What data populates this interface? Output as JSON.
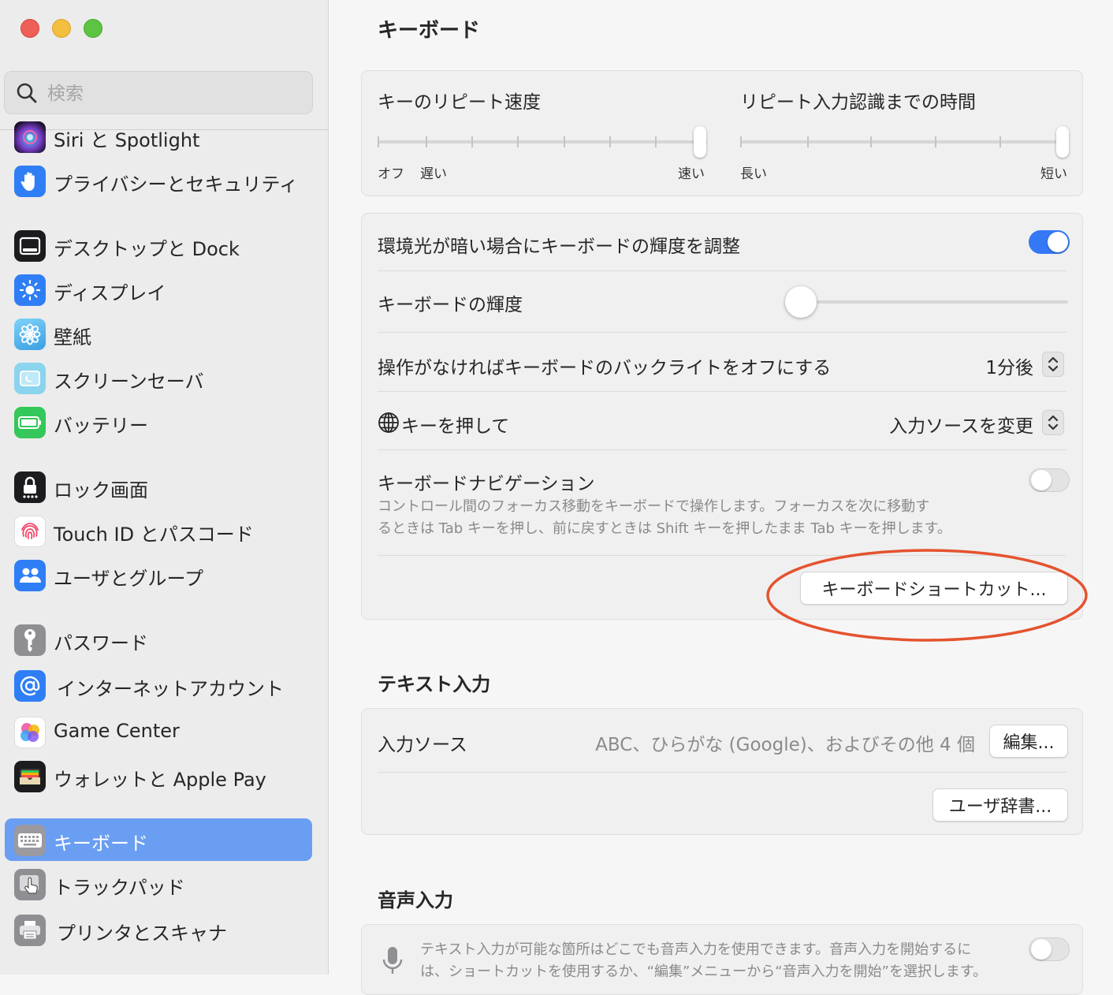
{
  "window": {
    "title": "キーボード"
  },
  "search": {
    "placeholder": "検索"
  },
  "sidebar": {
    "items": [
      {
        "label": "Siri と Spotlight",
        "icon": "siri-icon",
        "color": "#7b3fc9"
      },
      {
        "label": "プライバシーとセキュリティ",
        "icon": "hand-icon",
        "color": "#2f7ef5"
      },
      {
        "label": "デスクトップと Dock",
        "icon": "dock-icon",
        "color": "#1c1c1e"
      },
      {
        "label": "ディスプレイ",
        "icon": "display-sun-icon",
        "color": "#2f7ef5"
      },
      {
        "label": "壁紙",
        "icon": "wallpaper-flower-icon",
        "color": "#4fb3f0"
      },
      {
        "label": "スクリーンセーバ",
        "icon": "screensaver-icon",
        "color": "#5ac0e8"
      },
      {
        "label": "バッテリー",
        "icon": "battery-icon",
        "color": "#34c759"
      },
      {
        "label": "ロック画面",
        "icon": "lock-icon",
        "color": "#1c1c1e"
      },
      {
        "label": "Touch ID とパスコード",
        "icon": "fingerprint-icon",
        "color": "#ffffff"
      },
      {
        "label": "ユーザとグループ",
        "icon": "users-icon",
        "color": "#2f7ef5"
      },
      {
        "label": "パスワード",
        "icon": "key-icon",
        "color": "#8e8e93"
      },
      {
        "label": "インターネットアカウント",
        "icon": "at-icon",
        "color": "#2f7ef5"
      },
      {
        "label": "Game Center",
        "icon": "game-center-icon",
        "color": "#ffffff"
      },
      {
        "label": "ウォレットと Apple Pay",
        "icon": "wallet-icon",
        "color": "#1c1c1e"
      },
      {
        "label": "キーボード",
        "icon": "keyboard-icon",
        "color": "#8e8e93",
        "selected": true
      },
      {
        "label": "トラックパッド",
        "icon": "trackpad-icon",
        "color": "#8e8e93"
      },
      {
        "label": "プリンタとスキャナ",
        "icon": "printer-icon",
        "color": "#8e8e93"
      }
    ]
  },
  "repeat": {
    "speed_label": "キーのリピート速度",
    "speed_left1": "オフ",
    "speed_left2": "遅い",
    "speed_right": "速い",
    "speed_value_fraction": 1.0,
    "delay_label": "リピート入力認識までの時間",
    "delay_left": "長い",
    "delay_right": "短い",
    "delay_value_fraction": 1.0
  },
  "backlight": {
    "auto_label": "環境光が暗い場合にキーボードの輝度を調整",
    "auto_on": true,
    "brightness_label": "キーボードの輝度",
    "brightness_fraction": 0.0,
    "off_label": "操作がなければキーボードのバックライトをオフにする",
    "off_value": "1分後",
    "globe_label": "キーを押して",
    "globe_value": "入力ソースを変更",
    "nav_label": "キーボードナビゲーション",
    "nav_on": false,
    "nav_desc1": "コントロール間のフォーカス移動をキーボードで操作します。フォーカスを次に移動す",
    "nav_desc2": "るときは Tab キーを押し、前に戻すときは Shift キーを押したまま Tab キーを押します。",
    "shortcuts_button": "キーボードショートカット..."
  },
  "text_input": {
    "title": "テキスト入力",
    "sources_label": "入力ソース",
    "sources_value": "ABC、ひらがな (Google)、およびその他 4 個",
    "edit_button": "編集...",
    "dict_button": "ユーザ辞書..."
  },
  "dictation": {
    "title": "音声入力",
    "desc1": "テキスト入力が可能な箇所はどこでも音声入力を使用できます。音声入力を開始するに",
    "desc2": "は、ショートカットを使用するか、“編集”メニューから“音声入力を開始”を選択します。",
    "on": false
  },
  "colors": {
    "accent": "#3478f6",
    "selection": "#6a9ef2",
    "annotation": "#e4532f"
  }
}
